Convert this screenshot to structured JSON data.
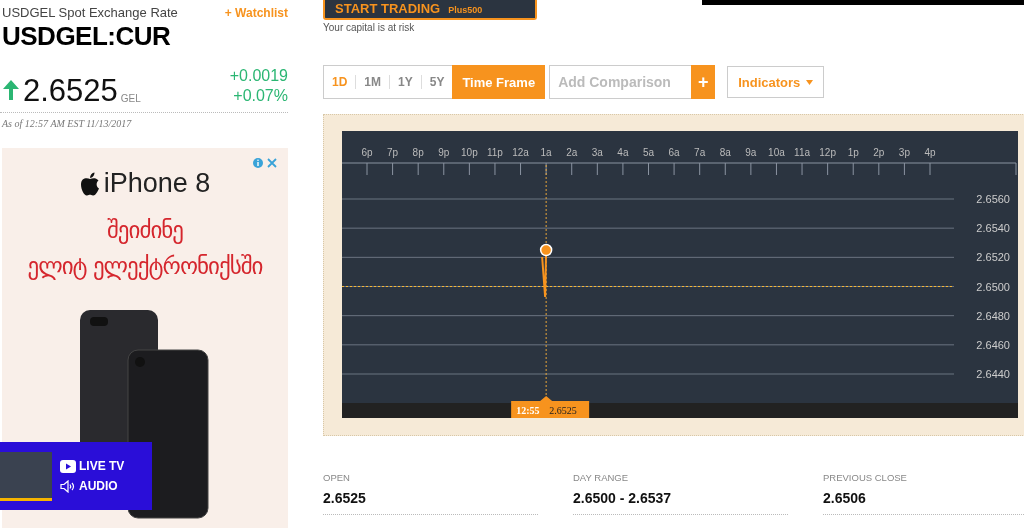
{
  "quote": {
    "title": "USDGEL Spot Exchange Rate",
    "watchlist": "+ Watchlist",
    "ticker": "USDGEL:CUR",
    "price": "2.6525",
    "currency": "GEL",
    "change": "+0.0019",
    "change_percent": "+0.07%",
    "timestamp": "As of 12:57 AM EST 11/13/2017"
  },
  "ad": {
    "brand": "iPhone 8",
    "headline": [
      "შეიძინე",
      "ელიტ ელექტრონიქსში"
    ]
  },
  "live": {
    "items": [
      {
        "kind": "video",
        "label": "LIVE TV"
      },
      {
        "kind": "audio",
        "label": "AUDIO"
      }
    ]
  },
  "trading": {
    "button": "START TRADING",
    "broker": "Plus500",
    "disclaimer": "Your capital is at risk"
  },
  "toolbar": {
    "ranges": [
      {
        "label": "1D",
        "selected": true
      },
      {
        "label": "1M",
        "selected": false
      },
      {
        "label": "1Y",
        "selected": false
      },
      {
        "label": "5Y",
        "selected": false
      }
    ],
    "time_frame": "Time Frame",
    "comparison_placeholder": "Add Comparison",
    "comparison_add": "+",
    "indicators": "Indicators"
  },
  "chart": {
    "chart_data": {
      "type": "line",
      "categories": [
        "6p",
        "7p",
        "8p",
        "9p",
        "10p",
        "11p",
        "12a",
        "1a",
        "2a",
        "3a",
        "4a",
        "5a",
        "6a",
        "7a",
        "8a",
        "9a",
        "10a",
        "11a",
        "12p",
        "1p",
        "2p",
        "3p",
        "4p"
      ],
      "series": [
        {
          "color": "#f7931e",
          "marker": "circle",
          "values": [
            null,
            null,
            null,
            null,
            null,
            null,
            null,
            2.6525,
            null,
            null,
            null,
            null,
            null,
            null,
            null,
            null,
            null,
            null,
            null,
            null,
            null,
            null,
            null
          ]
        }
      ],
      "ylim": [
        2.644,
        2.656
      ],
      "grid": true,
      "yticks": [
        {
          "value": 2.656,
          "label": "2.6560"
        },
        {
          "value": 2.654,
          "label": "2.6540"
        },
        {
          "value": 2.652,
          "label": "2.6520"
        },
        {
          "value": 2.65,
          "label": "2.6500"
        },
        {
          "value": 2.648,
          "label": "2.6480"
        },
        {
          "value": 2.646,
          "label": "2.6460"
        },
        {
          "value": 2.644,
          "label": "2.6440"
        }
      ]
    },
    "tooltip": {
      "time": "12:55",
      "value": "2.6525"
    }
  },
  "stats": [
    {
      "label": "OPEN",
      "value": "2.6525"
    },
    {
      "label": "DAY RANGE",
      "value": "2.6500 - 2.6537"
    },
    {
      "label": "PREVIOUS CLOSE",
      "value": "2.6506"
    }
  ]
}
